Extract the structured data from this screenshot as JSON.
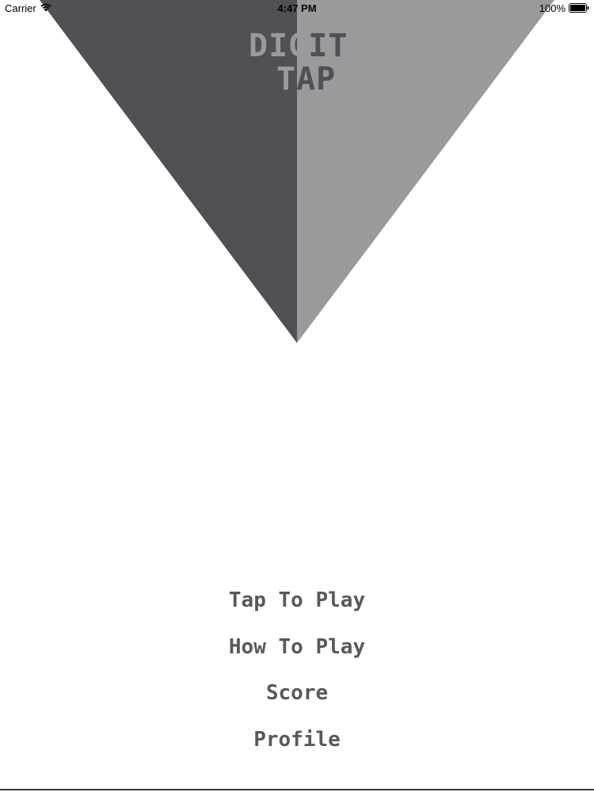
{
  "status_bar": {
    "carrier": "Carrier",
    "time": "4:47 PM",
    "battery": "100%"
  },
  "logo": {
    "line1": {
      "dark_part": "DIG",
      "light_part": "IT"
    },
    "line2": {
      "dark_part": "T",
      "light_part": "AP"
    }
  },
  "menu": {
    "items": [
      "Tap To Play",
      "How To Play",
      "Score",
      "Profile"
    ]
  },
  "colors": {
    "triangle_left": "#525054",
    "triangle_right": "#9b999c",
    "menu_text": "#5a585c",
    "background": "#ffffff"
  },
  "icons": {
    "wifi": "wifi-icon",
    "battery": "battery-icon"
  }
}
